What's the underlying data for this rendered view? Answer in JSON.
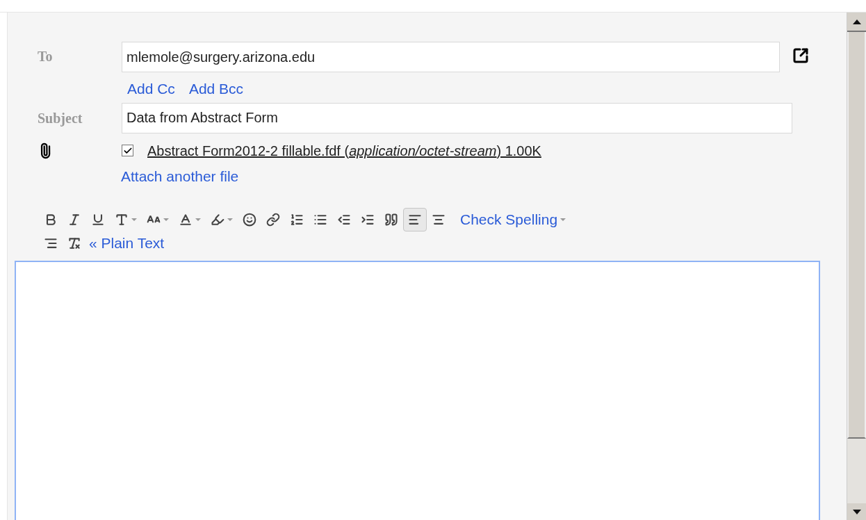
{
  "compose": {
    "to_label": "To",
    "to_value": "mlemole@surgery.arizona.edu",
    "add_cc": "Add Cc",
    "add_bcc": "Add Bcc",
    "subject_label": "Subject",
    "subject_value": "Data from Abstract Form",
    "attachment": {
      "checked": true,
      "name": "Abstract Form2012-2 fillable.fdf (*application/octet-stream*) 1.00K"
    },
    "attach_another": "Attach another file"
  },
  "toolbar": [
    {
      "kind": "bold",
      "dropdown": false,
      "selected": false
    },
    {
      "kind": "italic",
      "dropdown": false,
      "selected": false
    },
    {
      "kind": "underline",
      "dropdown": false,
      "selected": false
    },
    {
      "kind": "font",
      "dropdown": true,
      "selected": false
    },
    {
      "kind": "size",
      "dropdown": true,
      "selected": false
    },
    {
      "kind": "text-color",
      "dropdown": true,
      "selected": false
    },
    {
      "kind": "highlight",
      "dropdown": true,
      "selected": false
    },
    {
      "kind": "emoji",
      "dropdown": false,
      "selected": false
    },
    {
      "kind": "link",
      "dropdown": false,
      "selected": false
    },
    {
      "kind": "numbered-list",
      "dropdown": false,
      "selected": false
    },
    {
      "kind": "bulleted-list",
      "dropdown": false,
      "selected": false
    },
    {
      "kind": "indent-less",
      "dropdown": false,
      "selected": false
    },
    {
      "kind": "indent-more",
      "dropdown": false,
      "selected": false
    },
    {
      "kind": "quote",
      "dropdown": false,
      "selected": false
    },
    {
      "kind": "align-left",
      "dropdown": false,
      "selected": true
    },
    {
      "kind": "align-center",
      "dropdown": false,
      "selected": false
    }
  ],
  "check_spelling": "Check Spelling",
  "toolbar_row2": [
    {
      "kind": "align-right",
      "dropdown": false,
      "selected": false
    },
    {
      "kind": "remove-formatting",
      "dropdown": false,
      "selected": false
    }
  ],
  "plain_text": "« Plain Text"
}
